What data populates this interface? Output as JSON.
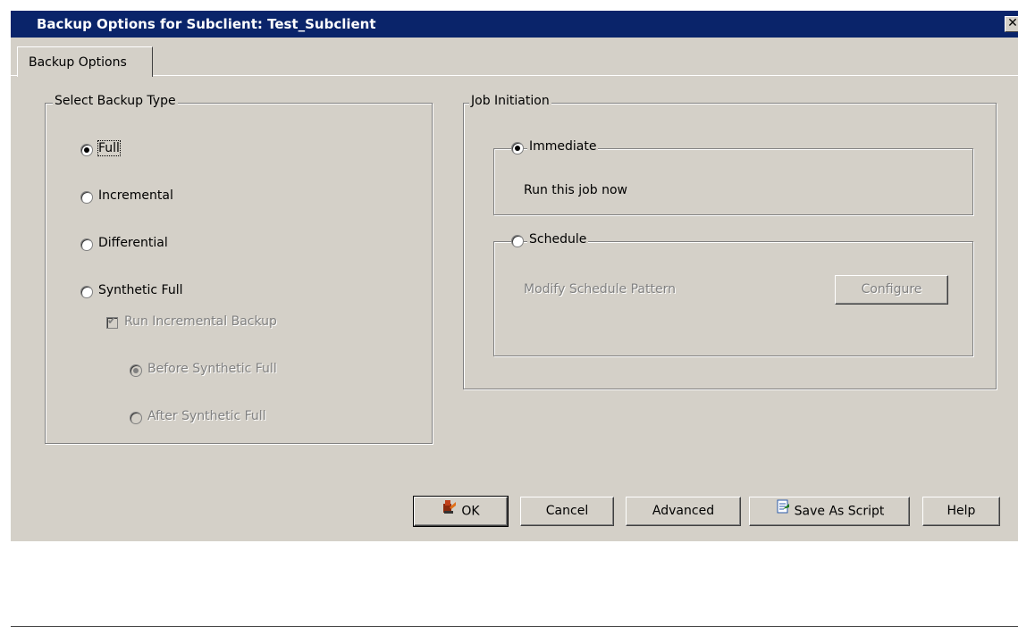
{
  "window": {
    "title": "Backup Options for Subclient: Test_Subclient",
    "close_glyph": "✕"
  },
  "tabs": [
    {
      "label": "Backup Options"
    }
  ],
  "backup_type": {
    "legend": "Select Backup Type",
    "options": [
      {
        "label": "Full",
        "checked": true
      },
      {
        "label": "Incremental",
        "checked": false
      },
      {
        "label": "Differential",
        "checked": false
      },
      {
        "label": "Synthetic Full",
        "checked": false
      }
    ],
    "run_incremental": {
      "label": "Run Incremental Backup",
      "checked": true,
      "enabled": false
    },
    "before_synthetic": {
      "label": "Before Synthetic Full",
      "checked": true,
      "enabled": false
    },
    "after_synthetic": {
      "label": "After Synthetic Full",
      "checked": false,
      "enabled": false
    }
  },
  "job_initiation": {
    "legend": "Job Initiation",
    "immediate": {
      "label": "Immediate",
      "checked": true,
      "description": "Run this job now"
    },
    "schedule": {
      "label": "Schedule",
      "checked": false,
      "pattern_label": "Modify Schedule Pattern",
      "configure_label": "Configure"
    }
  },
  "buttons": {
    "ok": "OK",
    "cancel": "Cancel",
    "advanced": "Advanced",
    "save_script": "Save As Script",
    "help": "Help"
  },
  "colors": {
    "titlebar": "#0a246a",
    "dialog_bg": "#d4d0c8"
  },
  "icons": {
    "ok": "ok-icon",
    "save_script": "save-script-icon",
    "close": "close-icon"
  }
}
